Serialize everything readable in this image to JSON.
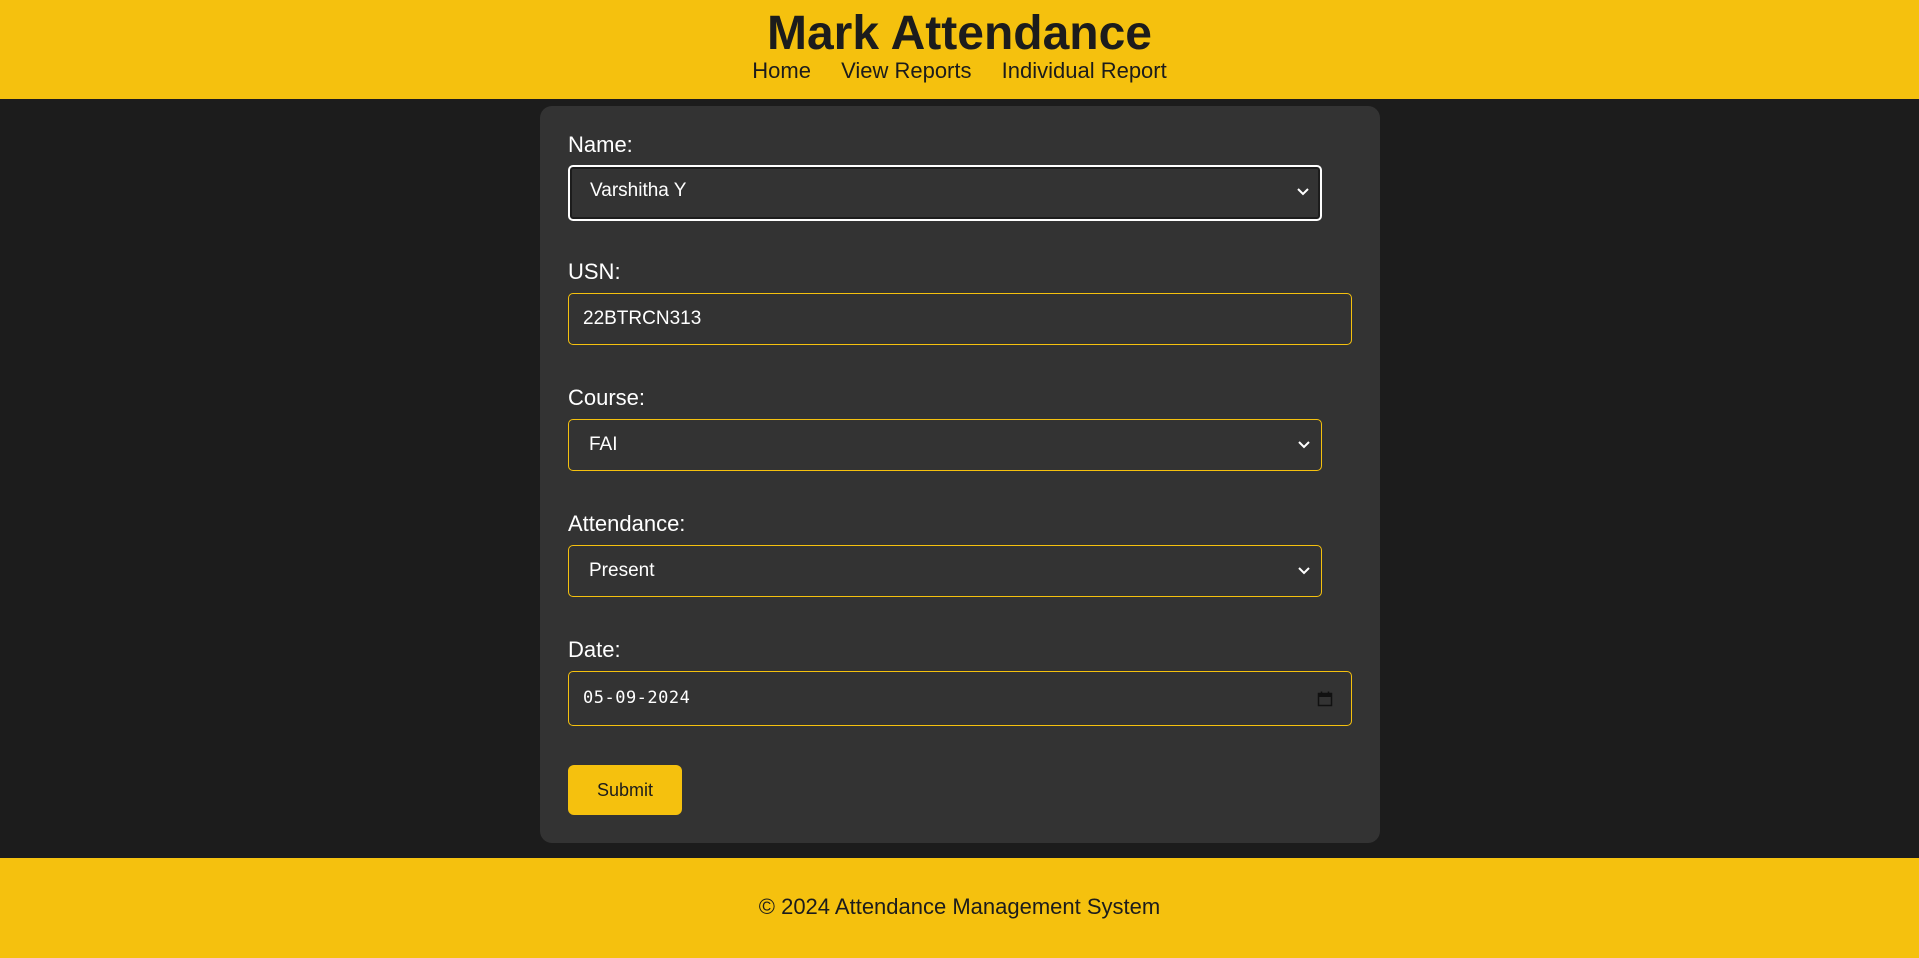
{
  "header": {
    "title": "Mark Attendance",
    "nav": [
      "Home",
      "View Reports",
      "Individual Report"
    ]
  },
  "form": {
    "name_label": "Name:",
    "name_value": "Varshitha Y",
    "usn_label": "USN:",
    "usn_value": "22BTRCN313",
    "course_label": "Course:",
    "course_value": "FAI",
    "attendance_label": "Attendance:",
    "attendance_value": "Present",
    "date_label": "Date:",
    "date_value": "05-09-2024",
    "submit_label": "Submit"
  },
  "footer": {
    "text": "© 2024 Attendance Management System"
  },
  "colors": {
    "accent": "#f5c10e",
    "background": "#1c1c1c",
    "card": "#333333"
  },
  "icons": [
    "chevron-down-icon",
    "calendar-icon"
  ]
}
